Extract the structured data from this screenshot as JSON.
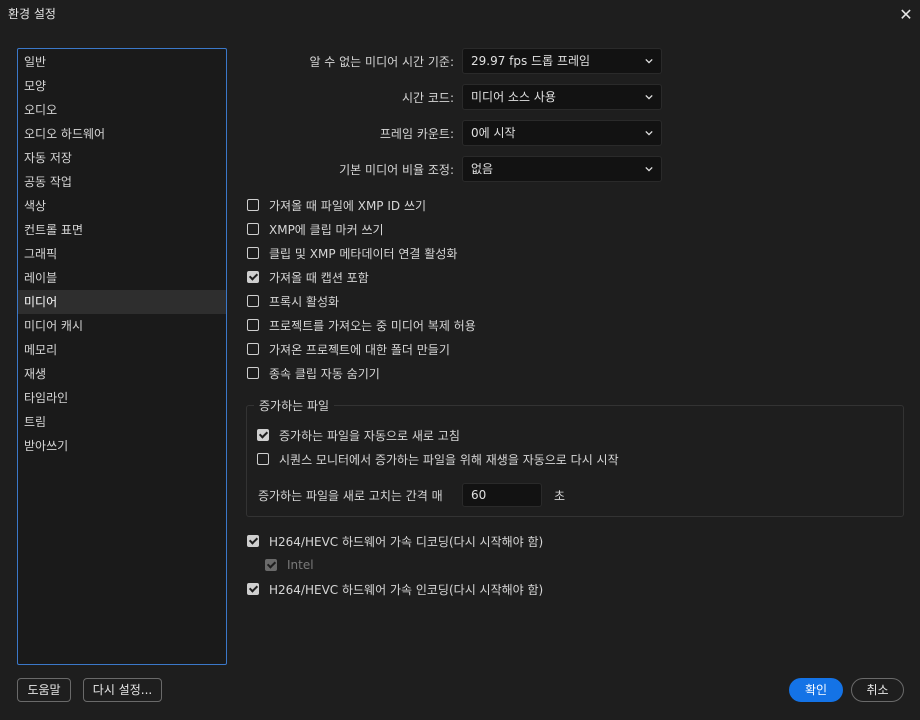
{
  "window": {
    "title": "환경 설정",
    "close_icon": "close-icon"
  },
  "sidebar": {
    "items": [
      {
        "label": "일반"
      },
      {
        "label": "모양"
      },
      {
        "label": "오디오"
      },
      {
        "label": "오디오 하드웨어"
      },
      {
        "label": "자동 저장"
      },
      {
        "label": "공동 작업"
      },
      {
        "label": "색상"
      },
      {
        "label": "컨트롤 표면"
      },
      {
        "label": "그래픽"
      },
      {
        "label": "레이블"
      },
      {
        "label": "미디어"
      },
      {
        "label": "미디어 캐시"
      },
      {
        "label": "메모리"
      },
      {
        "label": "재생"
      },
      {
        "label": "타임라인"
      },
      {
        "label": "트림"
      },
      {
        "label": "받아쓰기"
      }
    ],
    "selected": "미디어"
  },
  "settings": {
    "timebase": {
      "label": "알 수 없는 미디어 시간 기준:",
      "value": "29.97 fps 드롭 프레임"
    },
    "timecode": {
      "label": "시간 코드:",
      "value": "미디어 소스 사용"
    },
    "frame_count": {
      "label": "프레임 카운트:",
      "value": "0에 시작"
    },
    "pixel_aspect": {
      "label": "기본 미디어 비율 조정:",
      "value": "없음"
    }
  },
  "checkboxes": [
    {
      "label": "가져올 때 파일에 XMP ID 쓰기",
      "checked": false
    },
    {
      "label": "XMP에 클립 마커 쓰기",
      "checked": false
    },
    {
      "label": "클립 및 XMP 메타데이터 연결 활성화",
      "checked": false
    },
    {
      "label": "가져올 때 캡션 포함",
      "checked": true
    },
    {
      "label": "프록시 활성화",
      "checked": false
    },
    {
      "label": "프로젝트를 가져오는 중 미디어 복제 허용",
      "checked": false
    },
    {
      "label": "가져온 프로젝트에 대한 폴더 만들기",
      "checked": false
    },
    {
      "label": "종속 클립 자동 숨기기",
      "checked": false
    }
  ],
  "growing_files": {
    "legend": "증가하는 파일",
    "auto_refresh": {
      "label": "증가하는 파일을 자동으로 새로 고침",
      "checked": true
    },
    "restart_playback": {
      "label": "시퀀스 모니터에서 증가하는 파일을 위해 재생을 자동으로 다시 시작",
      "checked": false
    },
    "interval_label": "증가하는 파일을 새로 고치는 간격 매",
    "interval_value": "60",
    "interval_unit": "초"
  },
  "hardware": {
    "decode": {
      "label": "H264/HEVC 하드웨어 가속 디코딩(다시 시작해야 함)",
      "checked": true
    },
    "intel": {
      "label": "Intel",
      "checked": true,
      "disabled": true
    },
    "encode": {
      "label": "H264/HEVC 하드웨어 가속 인코딩(다시 시작해야 함)",
      "checked": true
    }
  },
  "footer": {
    "help": "도움말",
    "reset": "다시 설정...",
    "ok": "확인",
    "cancel": "취소"
  },
  "colors": {
    "accent": "#1473e6",
    "selection_border": "#3b78c9"
  }
}
